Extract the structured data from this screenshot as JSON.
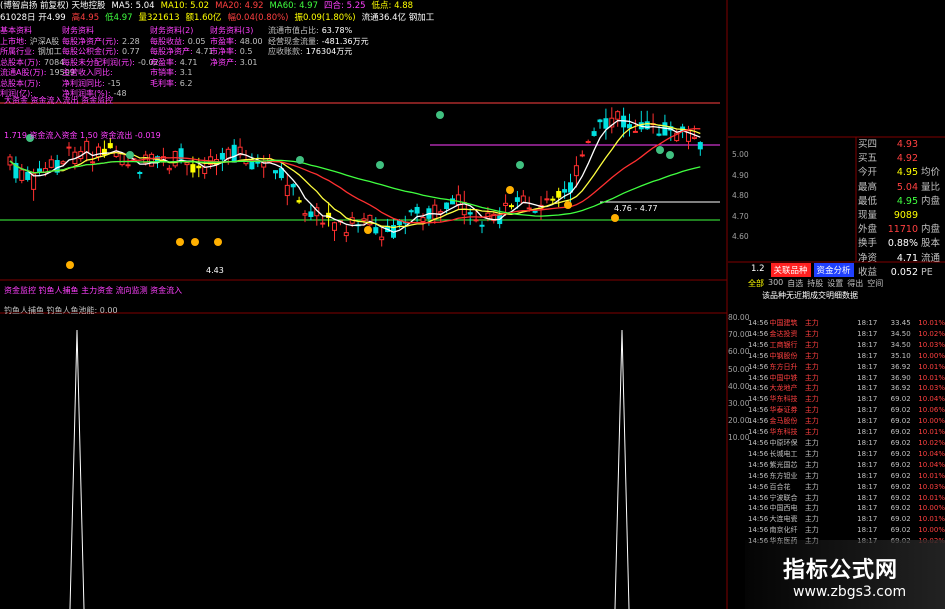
{
  "header": {
    "line1": [
      "(博智启扬 前复权) 天地控股",
      "MA5: 5.04",
      "MA10: 5.02",
      "MA20: 4.92",
      "MA60: 4.97",
      "四合: 5.25",
      "低点: 4.88"
    ],
    "line2": [
      "61028日 开4.99",
      "高4.95",
      "低4.97",
      "量321613",
      "额1.60亿",
      "幅0.04(0.80%)",
      "振0.09(1.80%)",
      "流通36.4亿 钢加工"
    ]
  },
  "fin_col1": [
    [
      "基本资料",
      ""
    ],
    [
      "上市地:",
      "沪深A股"
    ],
    [
      "所属行业:",
      "钢加工"
    ],
    [
      "总股本(万):",
      "7084"
    ],
    [
      "流通A股(万):",
      "19509"
    ],
    [
      "总股本(万):",
      ""
    ],
    [
      "利润(亿):",
      ""
    ]
  ],
  "fin_col2": [
    [
      "财务资料",
      ""
    ],
    [
      "每股净资产(元):",
      "2.28"
    ],
    [
      "每股公积金(元):",
      "0.77"
    ],
    [
      "每股未分配利润(元):",
      "-0.02"
    ],
    [
      "主营收入同比:",
      ""
    ],
    [
      "净利润同比:",
      "-15"
    ],
    [
      "净利润率(%):",
      "-48"
    ]
  ],
  "fin_col3": [
    [
      "财务资料(2)",
      ""
    ],
    [
      "每股收益:",
      "0.05"
    ],
    [
      "每股净资产:",
      "4.71"
    ],
    [
      "市盈率:",
      "4.71"
    ],
    [
      "市销率:",
      "3.1"
    ],
    [
      "毛利率:",
      "6.2"
    ]
  ],
  "fin_col4": [
    [
      "财务资料(3)",
      ""
    ],
    [
      "市盈率:",
      "48.00"
    ],
    [
      "市净率:",
      "0.5"
    ],
    [
      "净资产:",
      "3.01"
    ]
  ],
  "fin_col5": [
    [
      "流通市值占比:",
      "63.78%"
    ],
    [
      "经营现金流量:",
      "-481.36万元"
    ],
    [
      "应收账款:",
      "176304万元"
    ]
  ],
  "chart_labels": {
    "indicator1": "大资金 资金流入流出 资金监控",
    "indicator2": "1.719 资金流入资金 1.50 资金流出 -0.019",
    "low_label": "4.43",
    "range_label": "4.76 - 4.77",
    "sub_title": "钓鱼人捕鱼 钓鱼人鱼池能: 0.00",
    "sub_indicator": "资金监控 钓鱼人捕鱼 主力资金 流向监测 资金流入",
    "sub_left": "钓鱼人"
  },
  "price_scale": [
    "5.00",
    "4.90",
    "4.80",
    "4.70",
    "4.60"
  ],
  "sub_scale": [
    "80.00",
    "70.00",
    "60.00",
    "50.00",
    "40.00",
    "30.00",
    "20.00",
    "10.00"
  ],
  "quote": [
    {
      "label": "买四",
      "value": "4.93",
      "extra": ""
    },
    {
      "label": "买五",
      "value": "4.92",
      "extra": ""
    },
    {
      "label": "今开",
      "value": "4.95",
      "extra": "均价"
    },
    {
      "label": "最高",
      "value": "5.04",
      "extra": "量比"
    },
    {
      "label": "最低",
      "value": "4.95",
      "extra": "内盘"
    },
    {
      "label": "现量",
      "value": "9089",
      "extra": ""
    },
    {
      "label": "外盘",
      "value": "11710",
      "extra": "内盘"
    },
    {
      "label": "换手",
      "value": "0.88%",
      "extra": "股本"
    },
    {
      "label": "净资",
      "value": "4.71",
      "extra": "流通"
    },
    {
      "label": "收益",
      "value": "0.052",
      "extra": "PE"
    }
  ],
  "tabs": [
    "1.2",
    "关联品种",
    "资金分析"
  ],
  "subtabs": [
    "全部",
    "300",
    "自选",
    "持股",
    "设置",
    "得出",
    "空间"
  ],
  "notice": "该品种无近期成交明细数据",
  "trades": [
    [
      "14:56",
      "中国建筑",
      "主力",
      "18:17",
      "33.45",
      "10.01%"
    ],
    [
      "14:56",
      "金达投资",
      "主力",
      "18:17",
      "34.50",
      "10.02%"
    ],
    [
      "14:56",
      "工商银行",
      "主力",
      "18:17",
      "34.50",
      "10.03%"
    ],
    [
      "14:56",
      "中钢股份",
      "主力",
      "18:17",
      "35.10",
      "10.00%"
    ],
    [
      "14:56",
      "东方日升",
      "主力",
      "18:17",
      "36.92",
      "10.01%"
    ],
    [
      "14:56",
      "中国中铁",
      "主力",
      "18:17",
      "36.90",
      "10.01%"
    ],
    [
      "14:56",
      "大龙地产",
      "主力",
      "18:17",
      "36.92",
      "10.03%"
    ],
    [
      "14:56",
      "华东科技",
      "主力",
      "18:17",
      "69.02",
      "10.04%"
    ],
    [
      "14:56",
      "华泰证券",
      "主力",
      "18:17",
      "69.02",
      "10.06%"
    ],
    [
      "14:56",
      "金马股份",
      "主力",
      "18:17",
      "69.02",
      "10.00%"
    ],
    [
      "14:56",
      "华东科技",
      "主力",
      "18:17",
      "69.02",
      "10.01%"
    ],
    [
      "14:56",
      "中原环保",
      "主力",
      "18:17",
      "69.02",
      "10.02%"
    ],
    [
      "14:56",
      "长城电工",
      "主力",
      "18:17",
      "69.02",
      "10.04%"
    ],
    [
      "14:56",
      "紫光国芯",
      "主力",
      "18:17",
      "69.02",
      "10.04%"
    ],
    [
      "14:56",
      "东方钽业",
      "主力",
      "18:17",
      "69.02",
      "10.01%"
    ],
    [
      "14:56",
      "百合花",
      "主力",
      "18:17",
      "69.02",
      "10.03%"
    ],
    [
      "14:56",
      "宁波联合",
      "主力",
      "18:17",
      "69.02",
      "10.01%"
    ],
    [
      "14:56",
      "中国西电",
      "主力",
      "18:17",
      "69.02",
      "10.00%"
    ],
    [
      "14:56",
      "大连电瓷",
      "主力",
      "18:17",
      "69.02",
      "10.01%"
    ],
    [
      "14:56",
      "南京化纤",
      "主力",
      "18:17",
      "69.02",
      "10.00%"
    ],
    [
      "14:56",
      "华东医药",
      "主力",
      "18:17",
      "69.02",
      "10.02%"
    ]
  ],
  "watermark": {
    "title": "指标公式网",
    "url": "www.zbgs3.com"
  }
}
